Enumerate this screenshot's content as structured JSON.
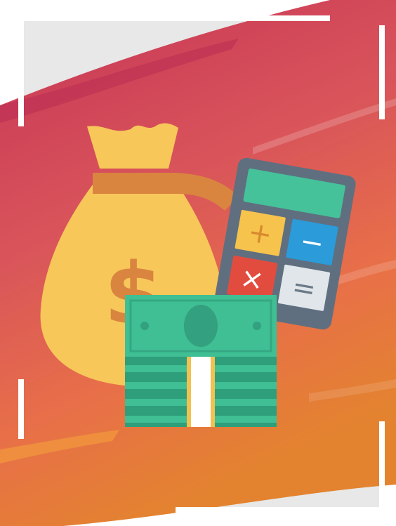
{
  "illustration": {
    "money_bag": {
      "symbol": "$",
      "icon": "money-bag-icon"
    },
    "calculator": {
      "icon": "calculator-icon",
      "keys": [
        "+",
        "−",
        "×",
        "="
      ]
    },
    "cash_stack": {
      "icon": "banknote-stack-icon"
    }
  },
  "colors": {
    "frame_background": "#e8e8e8",
    "brush_top": "#c8325a",
    "brush_bottom": "#e88a3a",
    "bag": "#f7c75a",
    "bag_symbol": "#d7863f",
    "calculator_body": "#5e6e7e",
    "calculator_screen": "#45c29a",
    "key_plus": "#f6c34d",
    "key_minus": "#2b9bd9",
    "key_times": "#e24c3f",
    "key_equals": "#e1e6ea",
    "cash": "#3fbf93",
    "cash_dark": "#2f9e7a"
  }
}
